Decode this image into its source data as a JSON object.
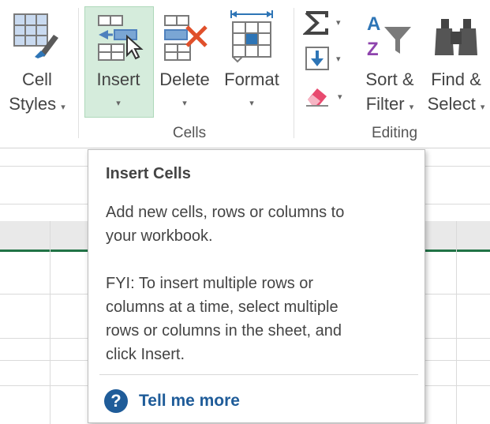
{
  "ribbon": {
    "cell_styles": {
      "line1": "Cell",
      "line2": "Styles",
      "arrow": "▾"
    },
    "insert": {
      "label": "Insert",
      "arrow": "▾"
    },
    "delete": {
      "label": "Delete",
      "arrow": "▾"
    },
    "format": {
      "label": "Format",
      "arrow": "▾"
    },
    "sort_filter": {
      "line1": "Sort &",
      "line2": "Filter",
      "arrow": "▾"
    },
    "find_select": {
      "line1": "Find &",
      "line2": "Select",
      "arrow": "▾"
    },
    "groups": {
      "cells": "Cells",
      "editing": "Editing"
    },
    "small_arrow": "▾"
  },
  "tooltip": {
    "title": "Insert Cells",
    "p1_l1": "Add new cells, rows or columns to",
    "p1_l2": "your workbook.",
    "p2_l1": "FYI: To insert multiple rows or",
    "p2_l2": "columns at a time, select multiple",
    "p2_l3": "rows or columns in the sheet, and",
    "p2_l4": "click Insert.",
    "help_glyph": "?",
    "help_label": "Tell me more"
  },
  "colors": {
    "hover": "#d5ecdc",
    "excel_green": "#217346",
    "help_blue": "#1f5c99",
    "delete_red": "#e0502b",
    "sort_purple": "#8e44ad",
    "accent_blue": "#2e75b6"
  }
}
